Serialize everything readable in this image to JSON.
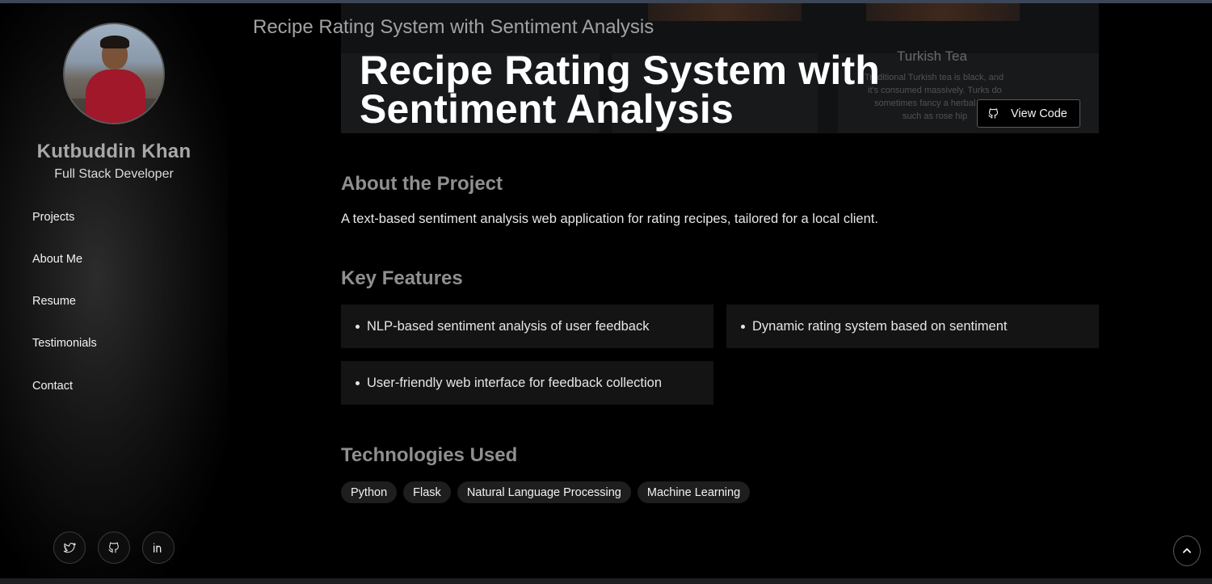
{
  "profile": {
    "name": "Kutbuddin Khan",
    "role": "Full Stack Developer"
  },
  "nav": {
    "items": [
      {
        "label": "Projects"
      },
      {
        "label": "About Me"
      },
      {
        "label": "Resume"
      },
      {
        "label": "Testimonials"
      },
      {
        "label": "Contact"
      }
    ]
  },
  "social": [
    {
      "icon": "twitter-icon"
    },
    {
      "icon": "github-icon"
    },
    {
      "icon": "linkedin-icon"
    }
  ],
  "header": {
    "sticky_title": "Recipe Rating System with Sentiment Analysis"
  },
  "hero": {
    "title_line1": "Recipe Rating System with",
    "title_line2": "Sentiment Analysis",
    "view_code_label": "View Code",
    "view_code_icon": "github-icon"
  },
  "about": {
    "heading": "About the Project",
    "text": "A text-based sentiment analysis web application for rating recipes, tailored for a local client."
  },
  "features": {
    "heading": "Key Features",
    "items": [
      "NLP-based sentiment analysis of user feedback",
      "Dynamic rating system based on sentiment",
      "User-friendly web interface for feedback collection"
    ]
  },
  "technologies": {
    "heading": "Technologies Used",
    "tags": [
      "Python",
      "Flask",
      "Natural Language Processing",
      "Machine Learning"
    ]
  },
  "scroll_top_icon": "chevron-up-icon",
  "colors": {
    "background": "#000000",
    "card": "#141414",
    "tag": "#1e1e1e",
    "heading_muted": "#8f8f8f"
  }
}
